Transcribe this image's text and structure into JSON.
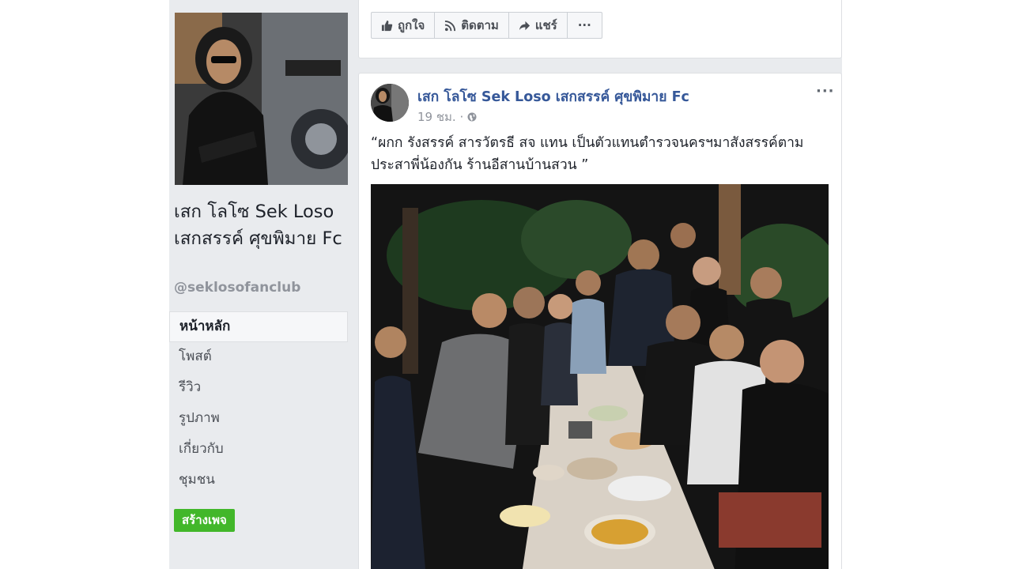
{
  "sidebar": {
    "page_name": "เสก โลโซ Sek Loso เสกสรรค์ ศุขพิมาย Fc",
    "handle": "@seklosofanclub",
    "nav": [
      "หน้าหลัก",
      "โพสต์",
      "รีวิว",
      "รูปภาพ",
      "เกี่ยวกับ",
      "ชุมชน"
    ],
    "create_page": "สร้างเพจ"
  },
  "top_actions": {
    "like": "ถูกใจ",
    "follow": "ติดตาม",
    "share": "แชร์",
    "more": "···"
  },
  "post": {
    "author": "เสก โลโซ Sek Loso เสกสรรค์ ศุขพิมาย Fc",
    "time": "19 ชม. ·",
    "more": "···",
    "text": "“ผกก รังสรรค์ สารวัตรธี สจ แทน เป็นตัวแทนตำรวจนครฯมาสังสรรค์ตาม ประสาพี่น้องกัน ร้านอีสานบ้านสวน ”"
  },
  "colors": {
    "link": "#365899",
    "green": "#42b72a",
    "bg": "#e9ebee"
  }
}
